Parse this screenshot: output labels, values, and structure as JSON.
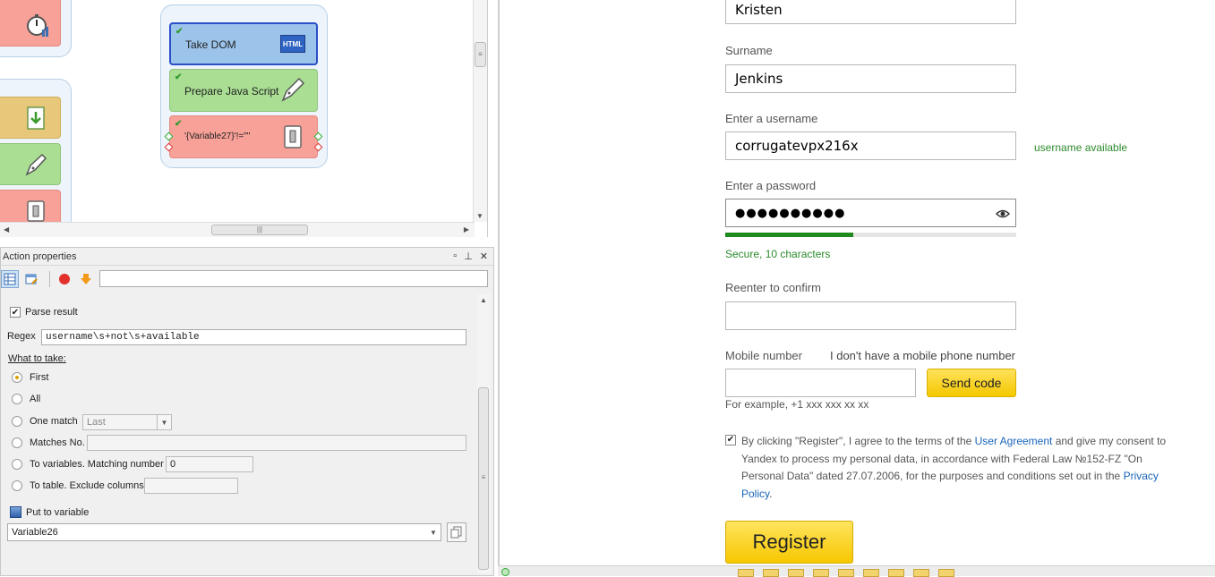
{
  "workflow": {
    "blocks": [
      {
        "label": "Take DOM",
        "icon": "html-icon",
        "color": "#9cc3ea"
      },
      {
        "label": "Prepare Java Script",
        "icon": "pen-icon",
        "color": "#a9de93"
      },
      {
        "label": "'{Variable27}'!=\"\"",
        "icon": "switch-icon",
        "color": "#f7a198"
      }
    ],
    "html_badge": "HTML"
  },
  "props": {
    "title": "Action properties",
    "parse_result_label": "Parse result",
    "regex_label": "Regex",
    "regex_value": "username\\s+not\\s+available",
    "what_to_take_label": "What to take:",
    "options": [
      {
        "label": "First",
        "selected": true
      },
      {
        "label": "All",
        "selected": false
      },
      {
        "label": "One match",
        "selected": false
      },
      {
        "label": "Matches No.",
        "selected": false
      },
      {
        "label": "To variables. Matching number",
        "selected": false
      },
      {
        "label": "To table. Exclude columns",
        "selected": false
      }
    ],
    "one_match_value": "Last",
    "matching_number_value": "0",
    "put_to_variable_label": "Put to variable",
    "variable_value": "Variable26"
  },
  "form": {
    "first_name_value": "Kristen",
    "surname_label": "Surname",
    "surname_value": "Jenkins",
    "username_label": "Enter a username",
    "username_value": "corrugatevpx216x",
    "username_status": "username available",
    "password_label": "Enter a password",
    "password_value": "●●●●●●●●●●",
    "password_strength": 0.44,
    "password_secure_text": "Secure, 10 characters",
    "confirm_label": "Reenter to confirm",
    "mobile_label": "Mobile number",
    "no_mobile_link": "I don't have a mobile phone number",
    "send_code_label": "Send code",
    "mobile_example": "For example, +1 xxx xxx xx xx",
    "agree_pre": "By clicking \"Register\", I agree to the terms of the ",
    "agree_link1": "User Agreement",
    "agree_mid": " and give my consent to Yandex to process my personal data, in accordance with Federal Law №152-FZ \"On Personal Data\" dated 27.07.2006, for the purposes and conditions set out in the ",
    "agree_link2": "Privacy Policy",
    "agree_post": ".",
    "register_label": "Register"
  },
  "colors": {
    "accent_green": "#2c8a2c",
    "yellow_button": "#f7c700",
    "link_blue": "#1a64b8"
  }
}
